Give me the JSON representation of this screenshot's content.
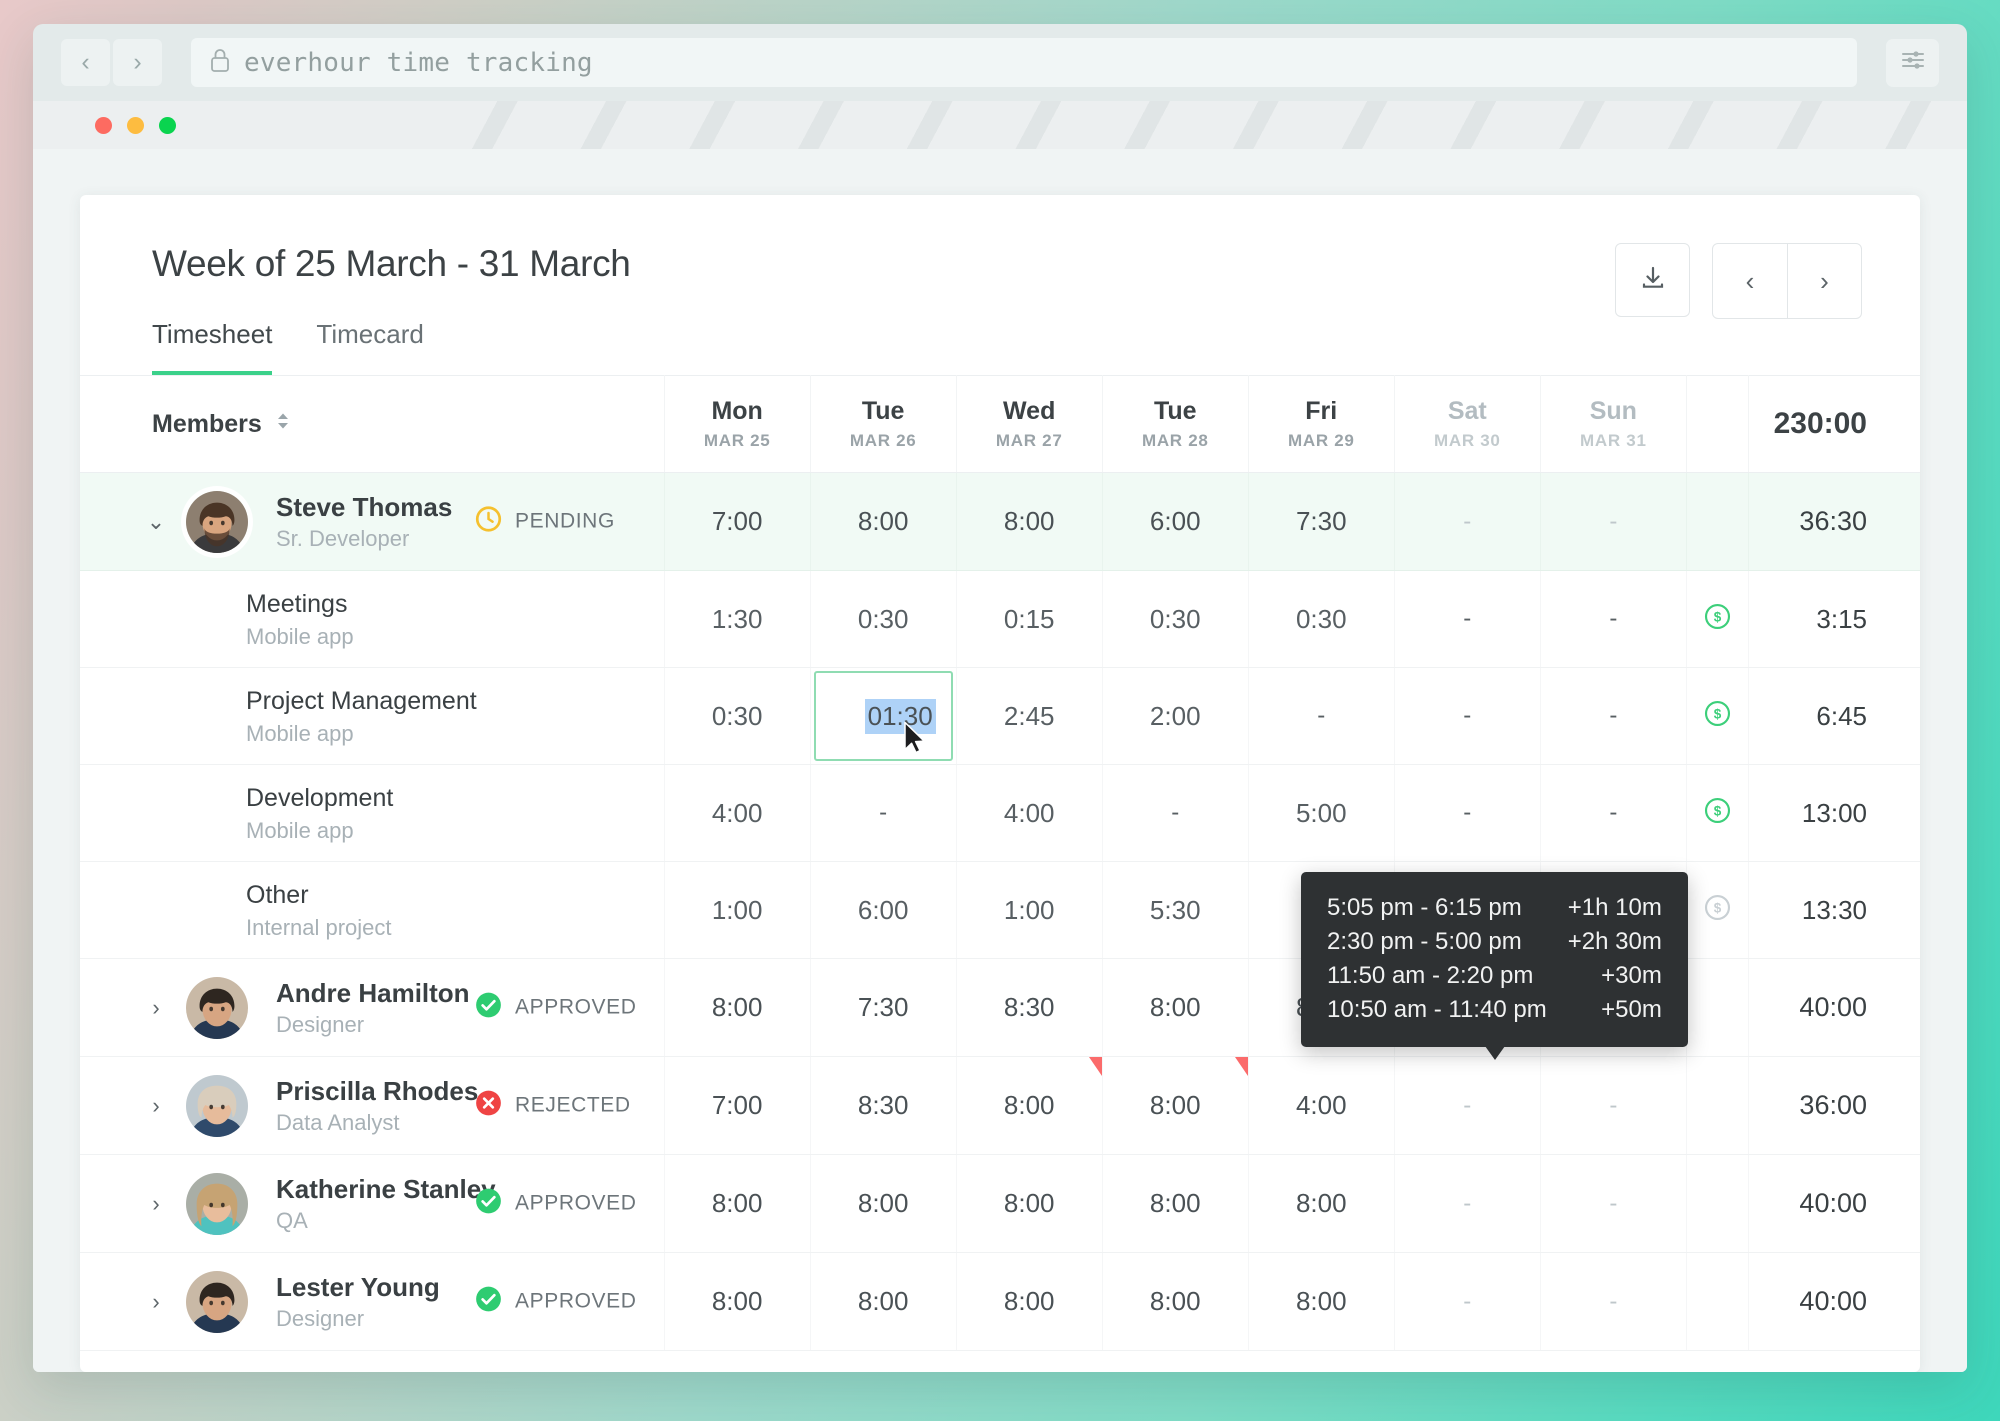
{
  "browser": {
    "back_label": "‹",
    "forward_label": "›",
    "url": "everhour time tracking",
    "lock_icon": "lock-icon",
    "settings_icon": "sliders-icon"
  },
  "header": {
    "title": "Week of 25 March - 31 March",
    "download_icon": "download-icon",
    "prev_label": "‹",
    "next_label": "›"
  },
  "tabs": [
    {
      "label": "Timesheet",
      "active": true
    },
    {
      "label": "Timecard",
      "active": false
    }
  ],
  "table": {
    "members_header": "Members",
    "sort_icon": "sort-updown-icon",
    "grand_total": "230:00",
    "days": [
      {
        "dow": "Mon",
        "date": "MAR 25",
        "weekend": false
      },
      {
        "dow": "Tue",
        "date": "MAR 26",
        "weekend": false
      },
      {
        "dow": "Wed",
        "date": "MAR 27",
        "weekend": false
      },
      {
        "dow": "Tue",
        "date": "MAR 28",
        "weekend": false
      },
      {
        "dow": "Fri",
        "date": "MAR 29",
        "weekend": false
      },
      {
        "dow": "Sat",
        "date": "MAR 30",
        "weekend": true
      },
      {
        "dow": "Sun",
        "date": "MAR 31",
        "weekend": true
      }
    ]
  },
  "rows": [
    {
      "type": "member",
      "name": "Steve Thomas",
      "role": "Sr. Developer",
      "status": "PENDING",
      "status_kind": "pending",
      "expanded": true,
      "values": [
        "7:00",
        "8:00",
        "8:00",
        "6:00",
        "7:30",
        "-",
        "-"
      ],
      "total": "36:30"
    },
    {
      "type": "entry",
      "task": "Meetings",
      "project": "Mobile app",
      "values": [
        "1:30",
        "0:30",
        "0:15",
        "0:30",
        "0:30",
        "-",
        "-"
      ],
      "billable": true,
      "total": "3:15"
    },
    {
      "type": "entry",
      "task": "Project Management",
      "project": "Mobile app",
      "values": [
        "0:30",
        "01:30",
        "2:45",
        "2:00",
        "-",
        "-",
        "-"
      ],
      "editing_index": 1,
      "editing_value": "01:30",
      "billable": true,
      "total": "6:45"
    },
    {
      "type": "entry",
      "task": "Development",
      "project": "Mobile app",
      "values": [
        "4:00",
        "-",
        "4:00",
        "-",
        "5:00",
        "-",
        "-"
      ],
      "billable": true,
      "total": "13:00"
    },
    {
      "type": "entry",
      "task": "Other",
      "project": "Internal project",
      "values": [
        "1:00",
        "6:00",
        "1:00",
        "5:30",
        "-",
        "-",
        "-"
      ],
      "billable": false,
      "total": "13:30"
    },
    {
      "type": "member",
      "name": "Andre Hamilton",
      "role": "Designer",
      "status": "APPROVED",
      "status_kind": "approved",
      "expanded": false,
      "values": [
        "8:00",
        "7:30",
        "8:30",
        "8:00",
        "8:00",
        "-",
        "-"
      ],
      "total": "40:00"
    },
    {
      "type": "member",
      "name": "Priscilla Rhodes",
      "role": "Data Analyst",
      "status": "REJECTED",
      "status_kind": "rejected",
      "expanded": false,
      "values": [
        "7:00",
        "8:30",
        "8:00",
        "8:00",
        "4:00",
        "-",
        "-"
      ],
      "flags": [
        2,
        3
      ],
      "total": "36:00"
    },
    {
      "type": "member",
      "name": "Katherine Stanley",
      "role": "QA",
      "status": "APPROVED",
      "status_kind": "approved",
      "expanded": false,
      "values": [
        "8:00",
        "8:00",
        "8:00",
        "8:00",
        "8:00",
        "-",
        "-"
      ],
      "total": "40:00"
    },
    {
      "type": "member",
      "name": "Lester Young",
      "role": "Designer",
      "status": "APPROVED",
      "status_kind": "approved",
      "expanded": false,
      "values": [
        "8:00",
        "8:00",
        "8:00",
        "8:00",
        "8:00",
        "-",
        "-"
      ],
      "total": "40:00"
    }
  ],
  "tooltip": {
    "entries": [
      {
        "range": "5:05 pm - 6:15 pm",
        "amount": "+1h 10m"
      },
      {
        "range": "2:30 pm - 5:00 pm",
        "amount": "+2h 30m"
      },
      {
        "range": "11:50 am - 2:20 pm",
        "amount": "+30m"
      },
      {
        "range": "10:50 am - 11:40 pm",
        "amount": "+50m"
      }
    ]
  },
  "colors": {
    "accent_green": "#3bd18a",
    "approved": "#2ecc71",
    "rejected": "#ef4444",
    "pending": "#f5c02e",
    "flag_red": "#fb6b6b",
    "selection_blue": "#aed2f7"
  }
}
